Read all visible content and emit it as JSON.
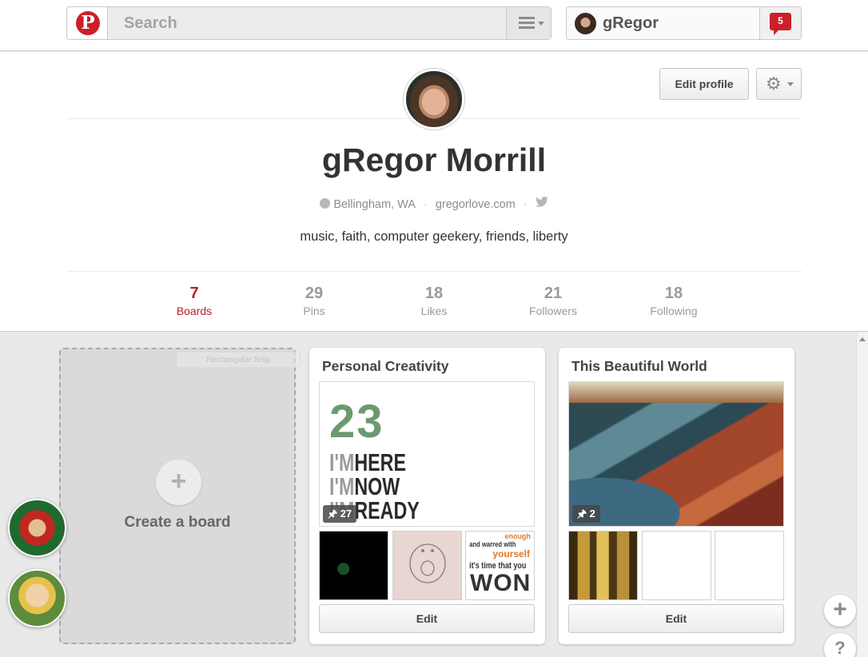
{
  "header": {
    "search_placeholder": "Search",
    "user_name": "gRegor",
    "notification_count": "5"
  },
  "profile": {
    "edit_profile_label": "Edit profile",
    "name": "gRegor Morrill",
    "location": "Bellingham, WA",
    "website": "gregorlove.com",
    "bio": "music, faith, computer geekery, friends, liberty",
    "stats": [
      {
        "count": "7",
        "label": "Boards",
        "active": true
      },
      {
        "count": "29",
        "label": "Pins",
        "active": false
      },
      {
        "count": "18",
        "label": "Likes",
        "active": false
      },
      {
        "count": "21",
        "label": "Followers",
        "active": false
      },
      {
        "count": "18",
        "label": "Following",
        "active": false
      }
    ]
  },
  "boards": {
    "create_label": "Create a board",
    "snip_ghost_label": "Rectangular Snip",
    "items": [
      {
        "title": "Personal Creativity",
        "pin_count": "27",
        "edit_label": "Edit",
        "cover_text": {
          "number": "23",
          "lines": [
            [
              "I'M",
              "HERE"
            ],
            [
              "I'M",
              "NOW"
            ],
            [
              "I'M",
              "READY"
            ]
          ]
        },
        "thumb3_text": [
          "enough",
          "and warred with",
          "yourself",
          "it's time that you",
          "WON"
        ]
      },
      {
        "title": "This Beautiful World",
        "pin_count": "2",
        "edit_label": "Edit"
      }
    ]
  },
  "floating": {
    "add_glyph": "+",
    "help_glyph": "?"
  },
  "colors": {
    "brand_red": "#cb2027",
    "active_stat": "#b9202a"
  }
}
